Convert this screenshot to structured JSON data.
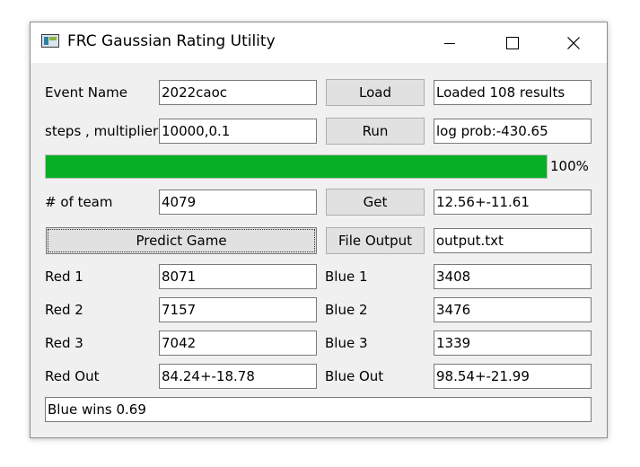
{
  "window": {
    "title": "FRC Gaussian Rating Utility"
  },
  "icons": {
    "app": "app-window-icon",
    "minimize": "minimize-icon",
    "maximize": "maximize-icon",
    "close": "close-icon"
  },
  "colors": {
    "progress_fill": "#06b025",
    "window_bg": "#f0f0f0"
  },
  "event": {
    "label": "Event Name",
    "value": "2022caoc",
    "button": "Load",
    "status": "Loaded 108 results"
  },
  "params": {
    "label": "steps , multiplier",
    "value": "10000,0.1",
    "button": "Run",
    "status": "log prob:-430.65"
  },
  "progress": {
    "value": 1.0,
    "text": "100%"
  },
  "team": {
    "label": "# of team",
    "value": "4079",
    "button": "Get",
    "result": "12.56+-11.61"
  },
  "predict": {
    "button": "Predict Game",
    "output_button": "File Output",
    "output_file": "output.txt"
  },
  "red": {
    "r1_label": "Red 1",
    "r1": "8071",
    "r2_label": "Red 2",
    "r2": "7157",
    "r3_label": "Red 3",
    "r3": "7042",
    "out_label": "Red Out",
    "out": "84.24+-18.78"
  },
  "blue": {
    "b1_label": "Blue 1",
    "b1": "3408",
    "b2_label": "Blue 2",
    "b2": "3476",
    "b3_label": "Blue 3",
    "b3": "1339",
    "out_label": "Blue Out",
    "out": "98.54+-21.99"
  },
  "result": {
    "text": "Blue wins 0.69"
  }
}
